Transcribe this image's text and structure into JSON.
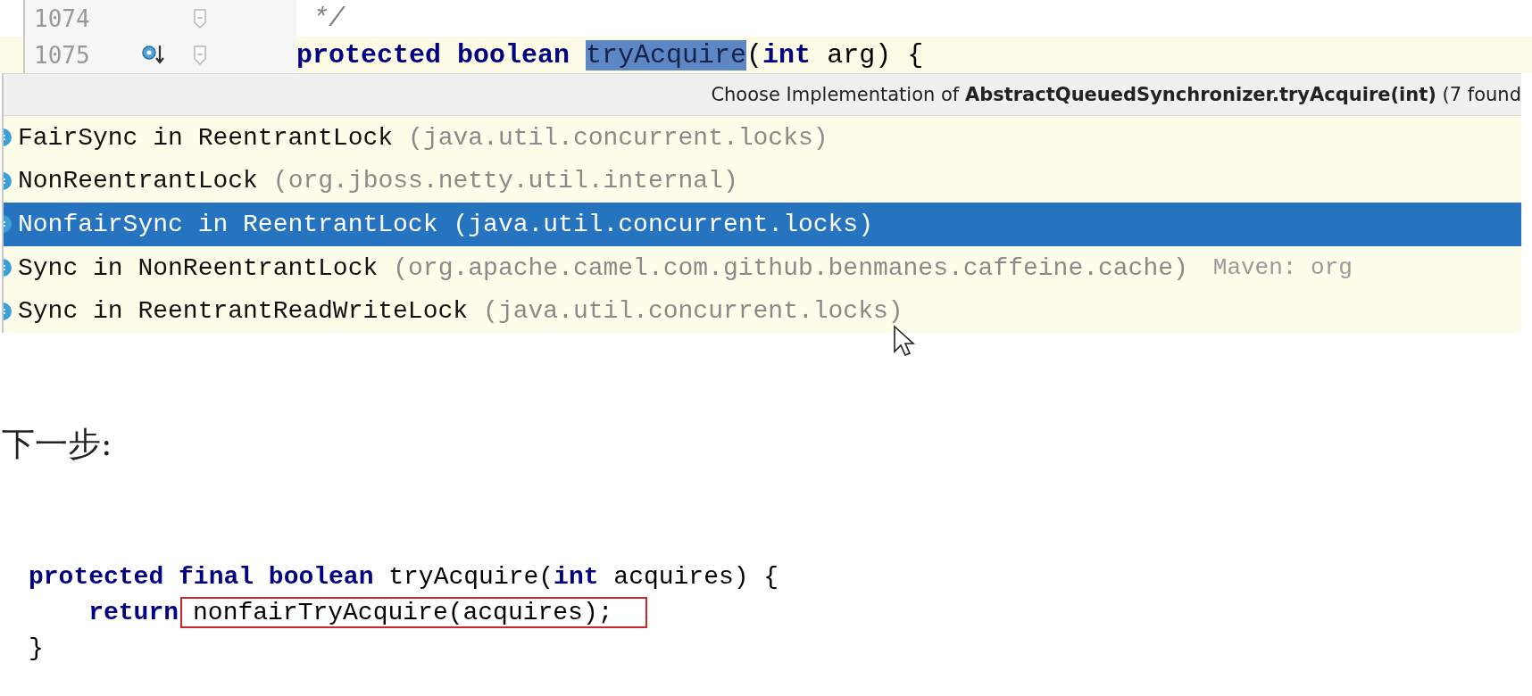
{
  "editor": {
    "lines": [
      {
        "number": "1074",
        "override_marker": false,
        "current": false,
        "tokens": [
          {
            "kind": "comment",
            "text": " */"
          }
        ]
      },
      {
        "number": "1075",
        "override_marker": true,
        "current": true,
        "tokens": [
          {
            "kind": "keyword",
            "text": "protected boolean "
          },
          {
            "kind": "highlight",
            "text": "tryAcquire"
          },
          {
            "kind": "plain",
            "text": "("
          },
          {
            "kind": "keyword",
            "text": "int "
          },
          {
            "kind": "plain",
            "text": "arg) {"
          }
        ]
      }
    ]
  },
  "popup": {
    "title": "Choose Implementation of **AbstractQueuedSynchronizer.tryAcquire(int)** (7 found",
    "items": [
      {
        "name": "FairSync in ReentrantLock",
        "package": "(java.util.concurrent.locks)",
        "selected": false
      },
      {
        "name": "NonReentrantLock",
        "package": "(org.jboss.netty.util.internal)",
        "selected": false
      },
      {
        "name": "NonfairSync in ReentrantLock",
        "package": "(java.util.concurrent.locks)",
        "selected": true
      },
      {
        "name": "Sync in NonReentrantLock",
        "package": "(org.apache.camel.com.github.benmanes.caffeine.cache)",
        "location": "Maven: org",
        "selected": false
      },
      {
        "name": "Sync in ReentrantReadWriteLock",
        "package": "(java.util.concurrent.locks)",
        "selected": false
      }
    ]
  },
  "heading": "下一步:",
  "code": [
    {
      "tokens": [
        {
          "kind": "keyword",
          "text": "protected final boolean "
        },
        {
          "kind": "plain",
          "text": "tryAcquire("
        },
        {
          "kind": "keyword",
          "text": "int "
        },
        {
          "kind": "plain",
          "text": "acquires) {"
        }
      ]
    },
    {
      "tokens": [
        {
          "kind": "keyword",
          "text": "    return"
        },
        {
          "kind": "boxed",
          "text": "nonfairTryAcquire(acquires);"
        }
      ]
    },
    {
      "tokens": [
        {
          "kind": "plain",
          "text": "}"
        }
      ]
    }
  ]
}
